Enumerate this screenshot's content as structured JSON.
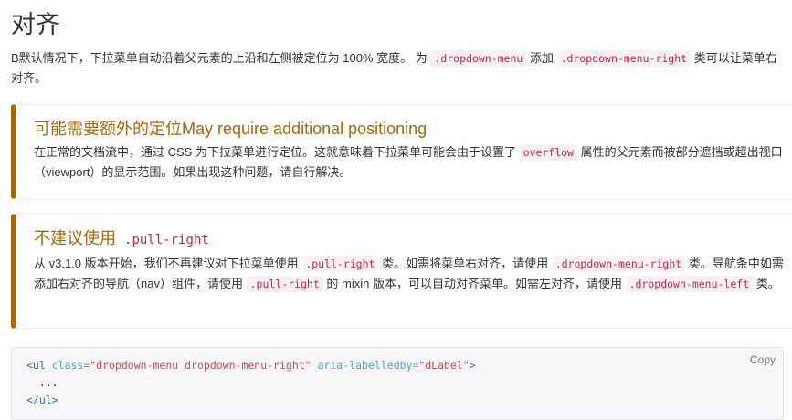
{
  "title": "对齐",
  "intro": {
    "t1": "B默认情况下，下拉菜单自动沿着父元素的上沿和左侧被定位为 100% 宽度。 为",
    "code1": ".dropdown-menu",
    "t2": "添加",
    "code2": ".dropdown-menu-right",
    "t3": "类可以让菜单右对齐。"
  },
  "callout1": {
    "heading": "可能需要额外的定位May require additional positioning",
    "t1": "在正常的文档流中，通过 CSS 为下拉菜单进行定位。这就意味着下拉菜单可能会由于设置了",
    "code1": "overflow",
    "t2": "属性的父元素而被部分遮挡或超出视口（viewport）的显示范围。如果出现这种问题，请自行解决。"
  },
  "callout2": {
    "heading": "不建议使用",
    "heading_code": ".pull-right",
    "t1": "从 v3.1.0 版本开始，我们不再建议对下拉菜单使用",
    "code1": ".pull-right",
    "t2": "类。如需将菜单右对齐，请使用",
    "code2": ".dropdown-menu-right",
    "t3": "类。导航条中如需添加右对齐的导航（nav）组件，请使用",
    "code3": ".pull-right",
    "t4": "的 mixin 版本，可以自动对齐菜单。如需左对齐，请使用",
    "code4": ".dropdown-menu-left",
    "t5": "类。"
  },
  "codeblock": {
    "copy_label": "Copy",
    "line1_open": "<ul",
    "line1_attr1": "class=",
    "line1_val1": "\"dropdown-menu dropdown-menu-right\"",
    "line1_attr2": "aria-labelledby=",
    "line1_val2": "\"dLabel\"",
    "line1_close": ">",
    "line2": "  ...",
    "line3": "</ul>"
  }
}
